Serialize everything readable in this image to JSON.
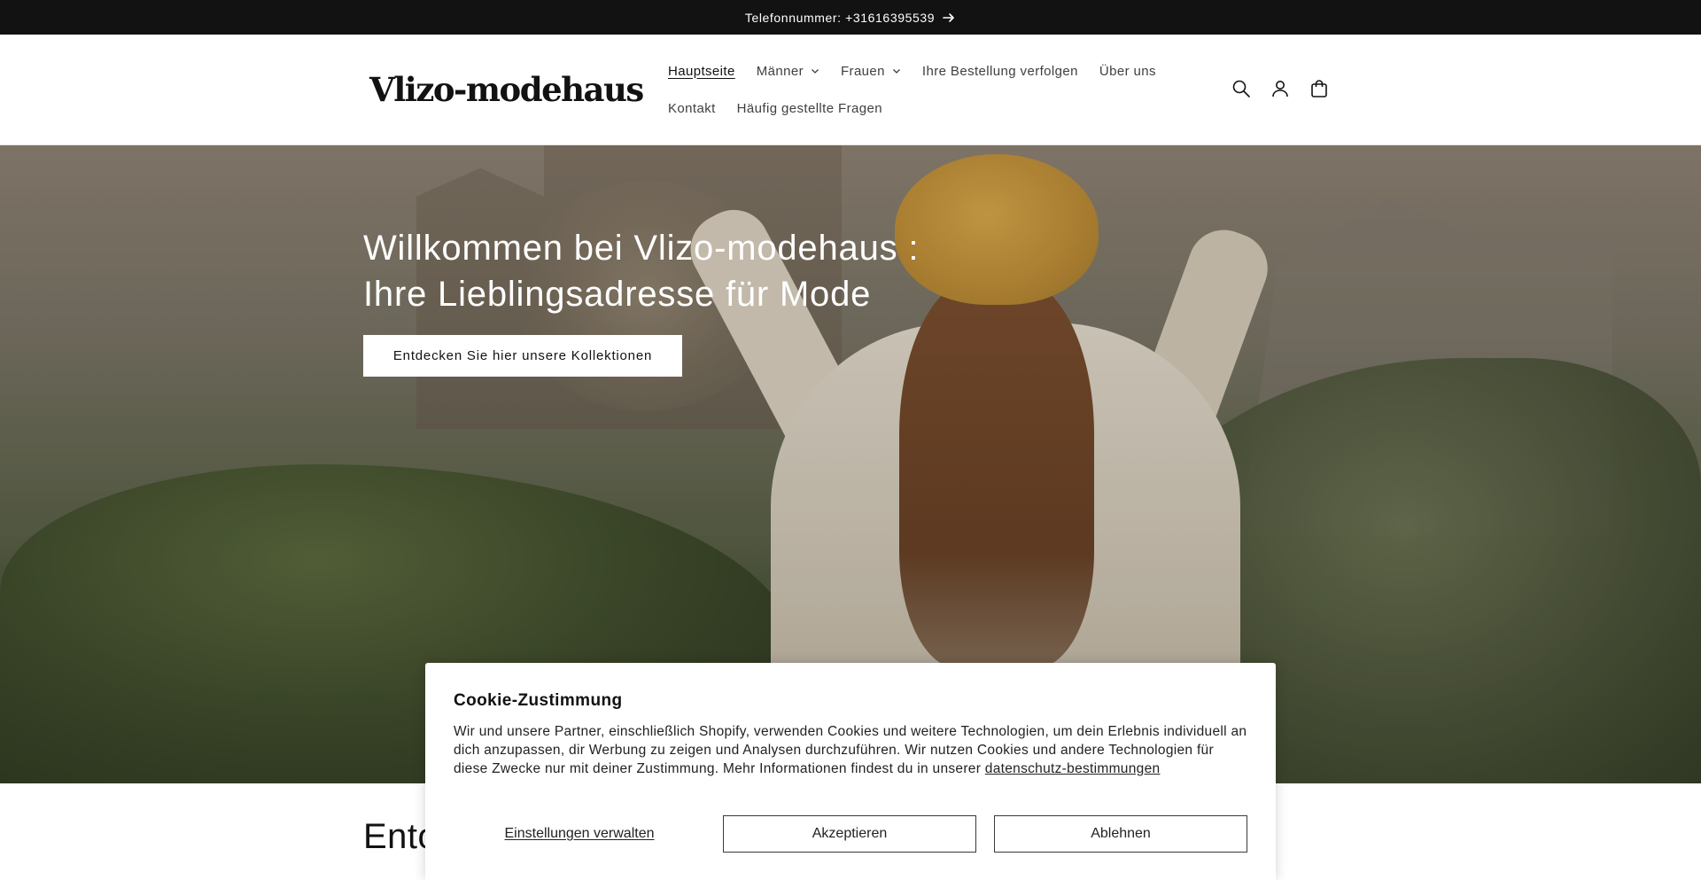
{
  "announcement": {
    "text": "Telefonnummer: +31616395539"
  },
  "header": {
    "logo": "Vlizo-modehaus",
    "nav_row1": [
      {
        "label": "Hauptseite",
        "active": true,
        "dropdown": false
      },
      {
        "label": "Männer",
        "active": false,
        "dropdown": true
      },
      {
        "label": "Frauen",
        "active": false,
        "dropdown": true
      },
      {
        "label": "Ihre Bestellung verfolgen",
        "active": false,
        "dropdown": false
      },
      {
        "label": "Über uns",
        "active": false,
        "dropdown": false
      }
    ],
    "nav_row2": [
      {
        "label": "Kontakt",
        "active": false,
        "dropdown": false
      },
      {
        "label": "Häufig gestellte Fragen",
        "active": false,
        "dropdown": false
      }
    ],
    "icons": [
      "search-icon",
      "account-icon",
      "cart-icon"
    ]
  },
  "hero": {
    "title_line1": "Willkommen bei Vlizo-modehaus :",
    "title_line2": "Ihre Lieblingsadresse für Mode",
    "button_label": "Entdecken Sie hier unsere Kollektionen"
  },
  "section": {
    "title_visible": "Ento"
  },
  "cookie": {
    "title": "Cookie-Zustimmung",
    "body": "Wir und unsere Partner, einschließlich Shopify, verwenden Cookies und weitere Technologien, um dein Erlebnis individuell an dich anzupassen, dir Werbung zu zeigen und Analysen durchzuführen. Wir nutzen Cookies und andere Technologien für diese Zwecke nur mit deiner Zustimmung. Mehr Informationen findest du in unserer ",
    "link": "datenschutz-bestimmungen",
    "manage_label": "Einstellungen verwalten",
    "accept_label": "Akzeptieren",
    "decline_label": "Ablehnen"
  },
  "colors": {
    "announcement_bg": "#121212",
    "text": "#121212",
    "nav_text": "#3f3f3f",
    "button_border": "#3a3a3a"
  }
}
